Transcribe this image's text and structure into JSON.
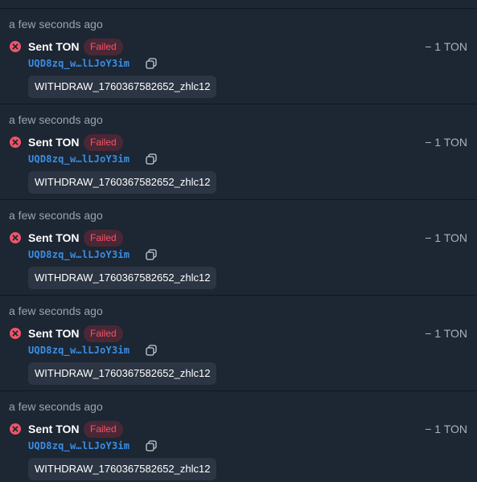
{
  "colors": {
    "background": "#1d2633",
    "divider": "#101720",
    "failed_text": "#ef5568",
    "failed_badge_bg": "#4a2735",
    "address": "#3a8ee6",
    "comment_bg": "#2c3543"
  },
  "transactions": [
    {
      "time": "a few seconds ago",
      "status_icon": "error-x-icon",
      "title": "Sent TON",
      "status": "Failed",
      "address": "UQD8zq_w…lLJoY3im",
      "copy_icon": "copy-icon",
      "comment": "WITHDRAW_1760367582652_zhlc12",
      "amount": "− 1 TON"
    },
    {
      "time": "a few seconds ago",
      "status_icon": "error-x-icon",
      "title": "Sent TON",
      "status": "Failed",
      "address": "UQD8zq_w…lLJoY3im",
      "copy_icon": "copy-icon",
      "comment": "WITHDRAW_1760367582652_zhlc12",
      "amount": "− 1 TON"
    },
    {
      "time": "a few seconds ago",
      "status_icon": "error-x-icon",
      "title": "Sent TON",
      "status": "Failed",
      "address": "UQD8zq_w…lLJoY3im",
      "copy_icon": "copy-icon",
      "comment": "WITHDRAW_1760367582652_zhlc12",
      "amount": "− 1 TON"
    },
    {
      "time": "a few seconds ago",
      "status_icon": "error-x-icon",
      "title": "Sent TON",
      "status": "Failed",
      "address": "UQD8zq_w…lLJoY3im",
      "copy_icon": "copy-icon",
      "comment": "WITHDRAW_1760367582652_zhlc12",
      "amount": "− 1 TON"
    },
    {
      "time": "a few seconds ago",
      "status_icon": "error-x-icon",
      "title": "Sent TON",
      "status": "Failed",
      "address": "UQD8zq_w…lLJoY3im",
      "copy_icon": "copy-icon",
      "comment": "WITHDRAW_1760367582652_zhlc12",
      "amount": "− 1 TON"
    }
  ]
}
